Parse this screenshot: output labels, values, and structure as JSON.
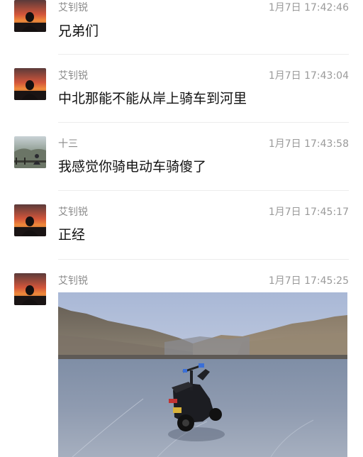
{
  "messages": [
    {
      "sender": "艾钊锐",
      "time": "1月7日 17:42:46",
      "text": "兄弟们"
    },
    {
      "sender": "艾钊锐",
      "time": "1月7日 17:43:04",
      "text": "中北那能不能从岸上骑车到河里"
    },
    {
      "sender": "十三",
      "time": "1月7日 17:43:58",
      "text": "我感觉你骑电动车骑傻了"
    },
    {
      "sender": "艾钊锐",
      "time": "1月7日 17:45:17",
      "text": "正经"
    },
    {
      "sender": "艾钊锐",
      "time": "1月7日 17:45:25"
    }
  ],
  "colors": {
    "sender": "#8a8a8a",
    "time": "#9a9a9a",
    "text": "#111111",
    "divider": "#ececec"
  },
  "icons": {
    "avatar_aizhaorui": "sunset-silhouette-avatar",
    "avatar_shisan": "landscape-figure-avatar",
    "photo": "scooter-on-frozen-river-photo"
  }
}
